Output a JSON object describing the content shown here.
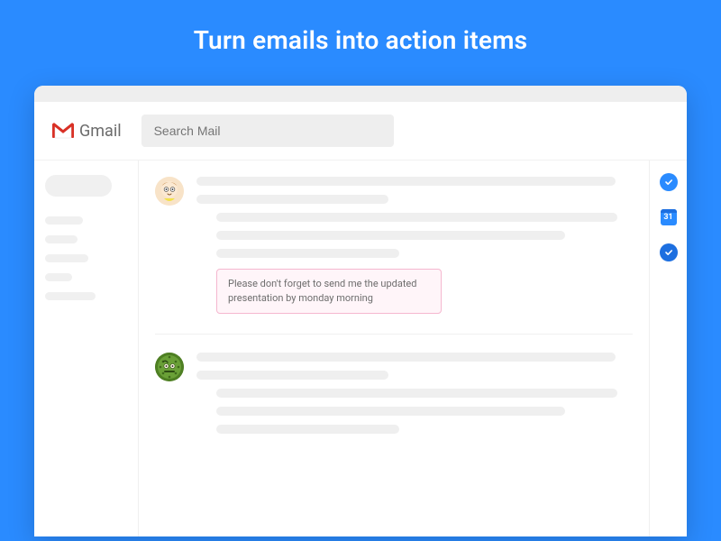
{
  "hero": {
    "title": "Turn emails into action items"
  },
  "header": {
    "product_name": "Gmail",
    "search_placeholder": "Search Mail"
  },
  "rail": {
    "calendar_day": "31"
  },
  "threads": [
    {
      "highlight": "Please don't forget to send me the updated presentation by monday morning"
    },
    {}
  ],
  "colors": {
    "accent": "#2a8bff",
    "highlight_border": "#f5b7cf",
    "highlight_bg": "#fff5f9"
  }
}
